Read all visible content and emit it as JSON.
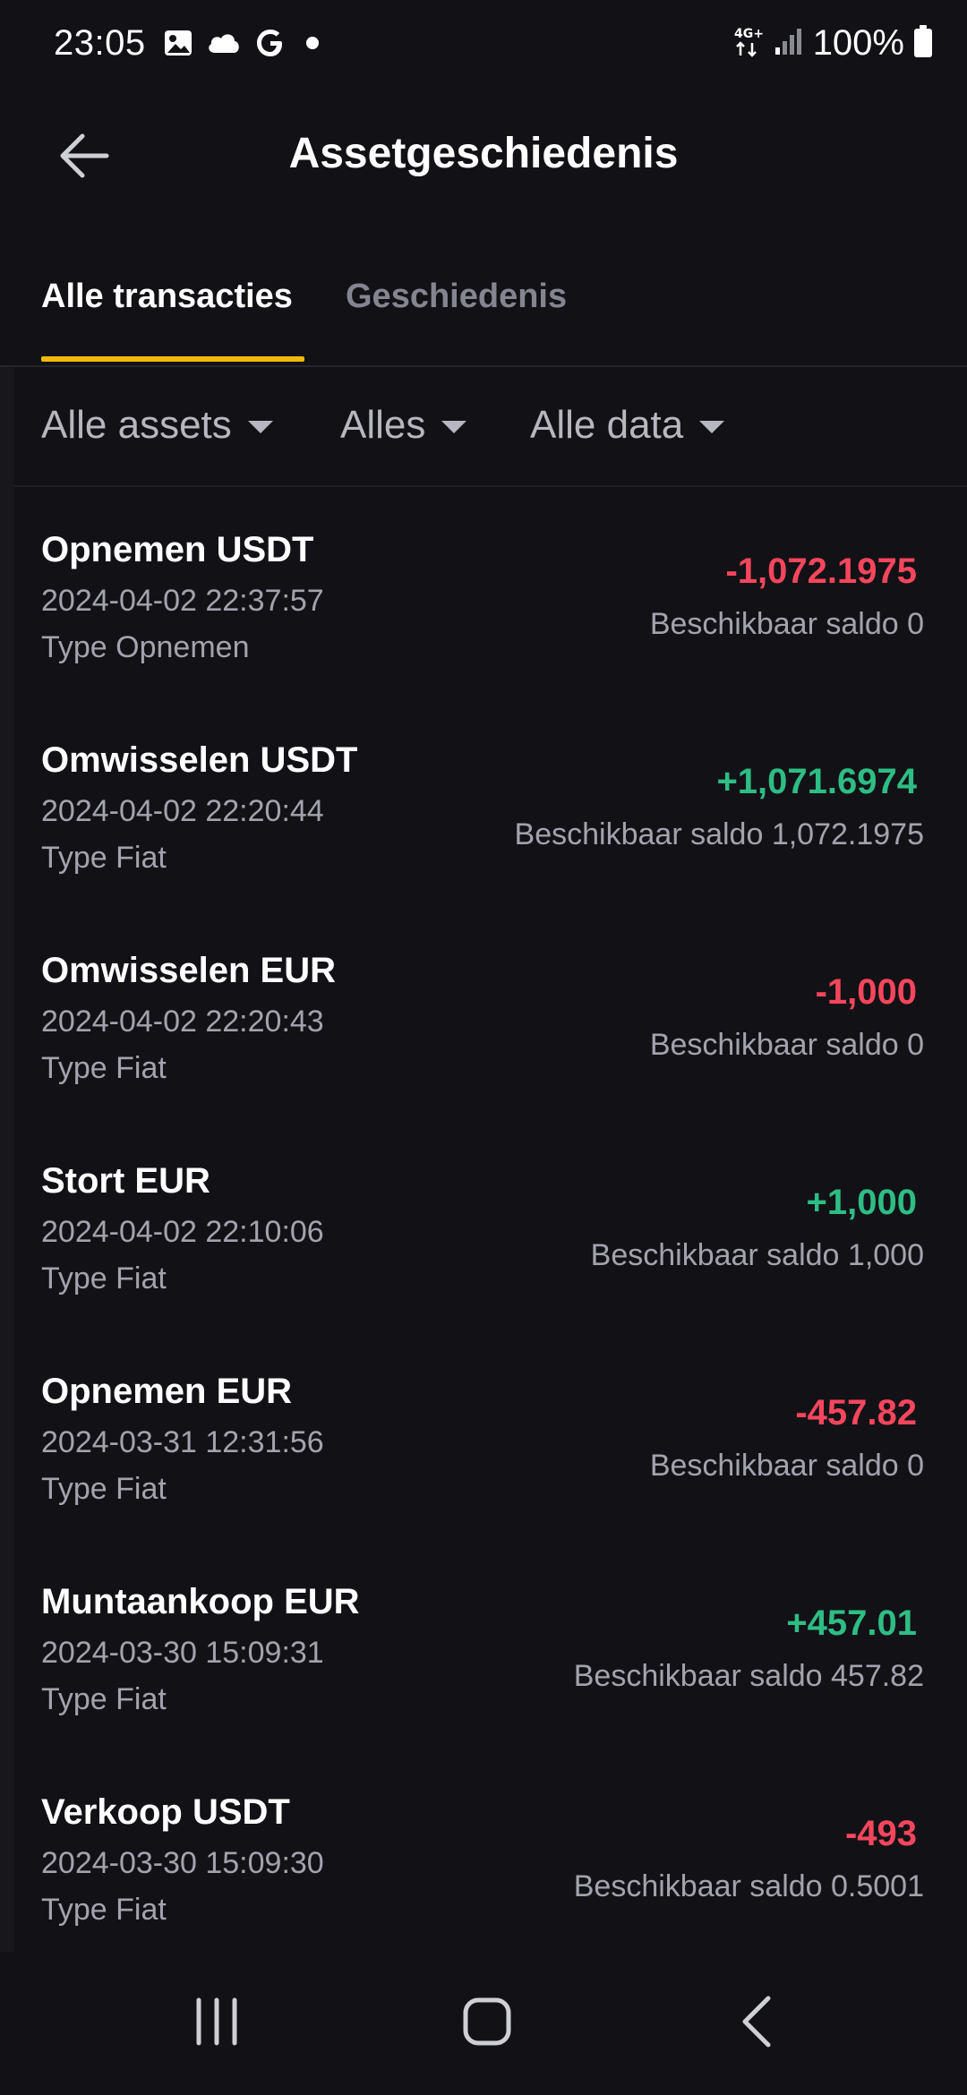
{
  "status_bar": {
    "time": "23:05",
    "left_icons": [
      "image-icon",
      "cloud-icon",
      "google-icon",
      "dot-icon"
    ],
    "network": "4G+",
    "battery": "100%"
  },
  "header": {
    "title": "Assetgeschiedenis",
    "back_icon": "arrow-left-icon"
  },
  "tabs": {
    "active": "Alle transacties",
    "inactive": "Geschiedenis",
    "accent_color": "#f0b90b"
  },
  "filters": {
    "assets": "Alle assets",
    "type": "Alles",
    "dates": "Alle data"
  },
  "colors": {
    "negative": "#f6465d",
    "positive": "#2ebd85",
    "background": "#121216"
  },
  "transactions": [
    {
      "title": "Opnemen USDT",
      "datetime": "2024-04-02 22:37:57",
      "type": "Type Opnemen",
      "amount": "-1,072.1975",
      "direction": "neg",
      "balance": "Beschikbaar saldo 0"
    },
    {
      "title": "Omwisselen USDT",
      "datetime": "2024-04-02 22:20:44",
      "type": "Type Fiat",
      "amount": "+1,071.6974",
      "direction": "pos",
      "balance": "Beschikbaar saldo 1,072.1975"
    },
    {
      "title": "Omwisselen EUR",
      "datetime": "2024-04-02 22:20:43",
      "type": "Type Fiat",
      "amount": "-1,000",
      "direction": "neg",
      "balance": "Beschikbaar saldo 0"
    },
    {
      "title": "Stort EUR",
      "datetime": "2024-04-02 22:10:06",
      "type": "Type Fiat",
      "amount": "+1,000",
      "direction": "pos",
      "balance": "Beschikbaar saldo 1,000"
    },
    {
      "title": "Opnemen EUR",
      "datetime": "2024-03-31 12:31:56",
      "type": "Type Fiat",
      "amount": "-457.82",
      "direction": "neg",
      "balance": "Beschikbaar saldo 0"
    },
    {
      "title": "Muntaankoop EUR",
      "datetime": "2024-03-30 15:09:31",
      "type": "Type Fiat",
      "amount": "+457.01",
      "direction": "pos",
      "balance": "Beschikbaar saldo 457.82"
    },
    {
      "title": "Verkoop USDT",
      "datetime": "2024-03-30 15:09:30",
      "type": "Type Fiat",
      "amount": "-493",
      "direction": "neg",
      "balance": "Beschikbaar saldo 0.5001"
    }
  ],
  "nav_bar": {
    "recents_icon": "recents-icon",
    "home_icon": "home-icon",
    "back_icon": "back-chevron-icon"
  }
}
